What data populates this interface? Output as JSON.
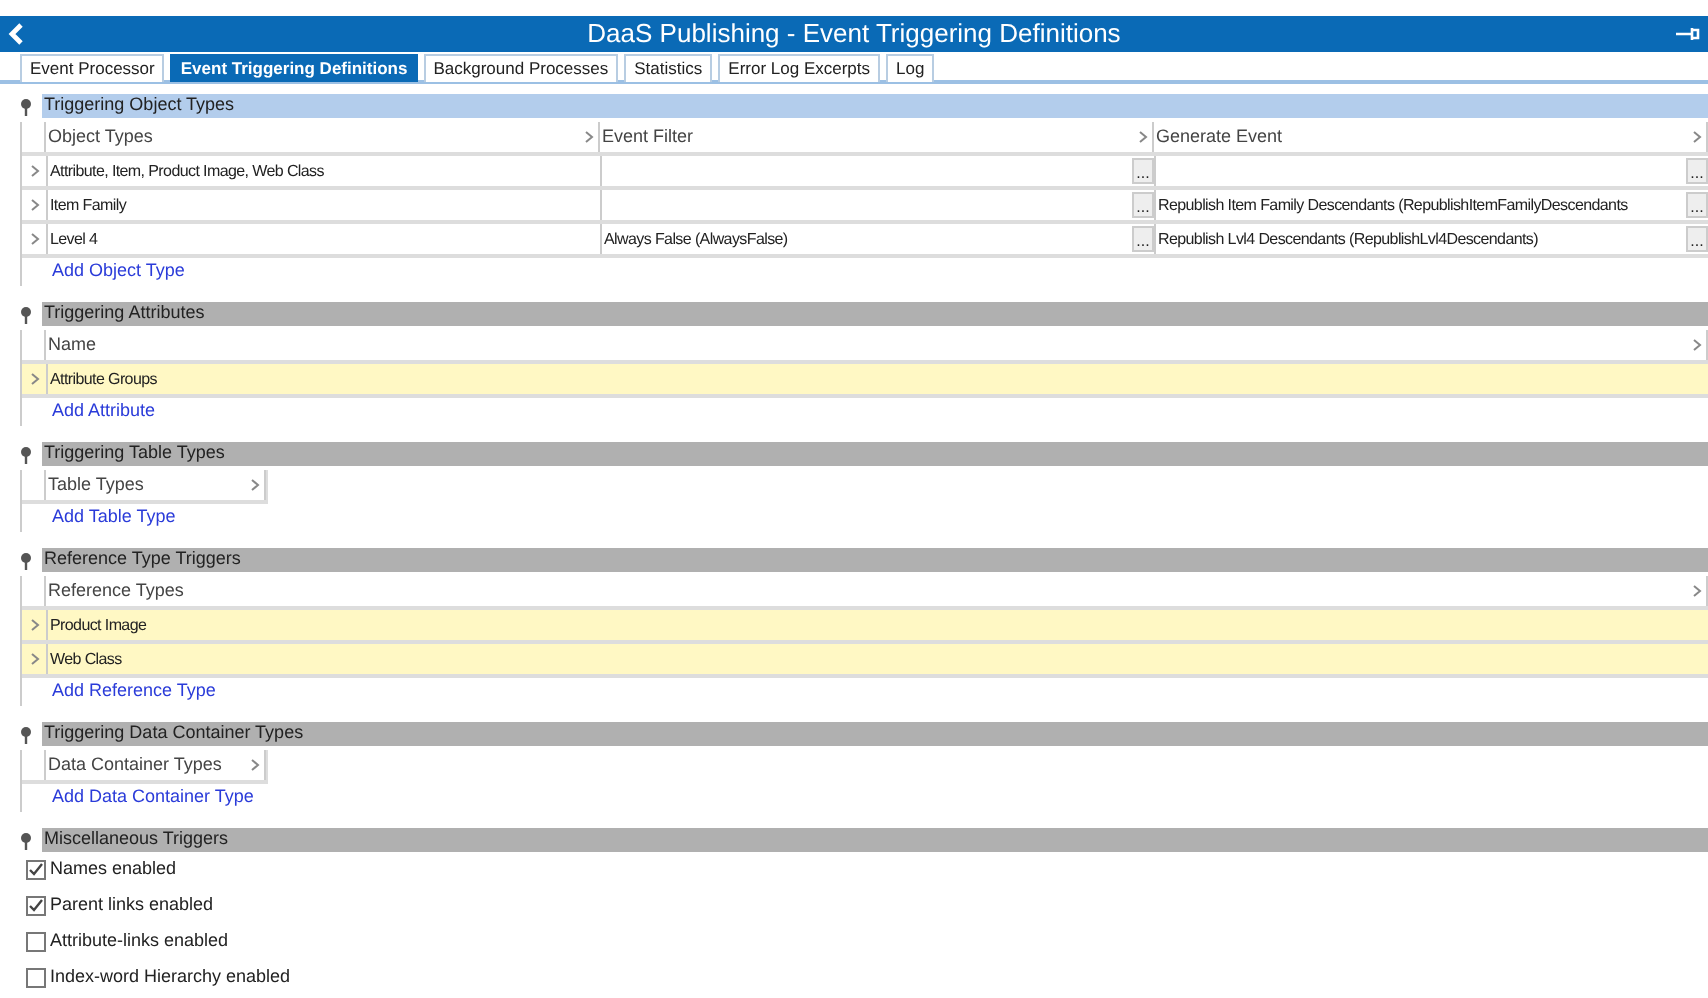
{
  "window": {
    "title": "DaaS Publishing - Event Triggering Definitions"
  },
  "tabs": [
    {
      "label": "Event Processor",
      "selected": false
    },
    {
      "label": "Event Triggering Definitions",
      "selected": true
    },
    {
      "label": "Background Processes",
      "selected": false
    },
    {
      "label": "Statistics",
      "selected": false
    },
    {
      "label": "Error Log Excerpts",
      "selected": false
    },
    {
      "label": "Log",
      "selected": false
    }
  ],
  "sections": [
    {
      "title": "Triggering Object Types",
      "selected": true,
      "kind": "table",
      "compact": false,
      "columns": [
        "Object Types",
        "Event Filter",
        "Generate Event"
      ],
      "rows": [
        {
          "highlighted": false,
          "cells": [
            {
              "value": "Attribute, Item, Product Image, Web Class"
            },
            {
              "button": "..."
            },
            {
              "button": "..."
            }
          ]
        },
        {
          "highlighted": false,
          "cells": [
            {
              "value": "Item Family"
            },
            {
              "button": "..."
            },
            {
              "value": "Republish Item Family Descendants (RepublishItemFamilyDescendants",
              "button": "..."
            }
          ]
        },
        {
          "highlighted": false,
          "cells": [
            {
              "value": "Level 4"
            },
            {
              "value": "Always False (AlwaysFalse)",
              "button": "..."
            },
            {
              "value": "Republish Lvl4 Descendants (RepublishLvl4Descendants)",
              "button": "..."
            }
          ]
        }
      ],
      "add_link": "Add Object Type"
    },
    {
      "title": "Triggering Attributes",
      "selected": false,
      "kind": "table",
      "compact": false,
      "columns": [
        "Name"
      ],
      "rows": [
        {
          "highlighted": true,
          "cells": [
            {
              "value": "Attribute Groups"
            }
          ]
        }
      ],
      "add_link": "Add Attribute"
    },
    {
      "title": "Triggering Table Types",
      "selected": false,
      "kind": "table",
      "compact": true,
      "columns": [
        "Table Types"
      ],
      "add_link": "Add Table Type"
    },
    {
      "title": "Reference Type Triggers",
      "selected": false,
      "kind": "table",
      "compact": false,
      "columns": [
        "Reference Types"
      ],
      "rows": [
        {
          "highlighted": true,
          "cells": [
            {
              "value": "Product Image"
            }
          ]
        },
        {
          "highlighted": true,
          "cells": [
            {
              "value": "Web Class"
            }
          ]
        }
      ],
      "add_link": "Add Reference Type"
    },
    {
      "title": "Triggering Data Container Types",
      "selected": false,
      "kind": "table",
      "compact": true,
      "columns": [
        "Data Container Types"
      ],
      "add_link": "Add Data Container Type"
    },
    {
      "title": "Miscellaneous Triggers",
      "selected": false,
      "kind": "checkboxes",
      "options": [
        {
          "label": "Names enabled",
          "checked": true
        },
        {
          "label": "Parent links enabled",
          "checked": true
        },
        {
          "label": "Attribute-links enabled",
          "checked": false
        },
        {
          "label": "Index-word Hierarchy enabled",
          "checked": false
        }
      ]
    }
  ]
}
